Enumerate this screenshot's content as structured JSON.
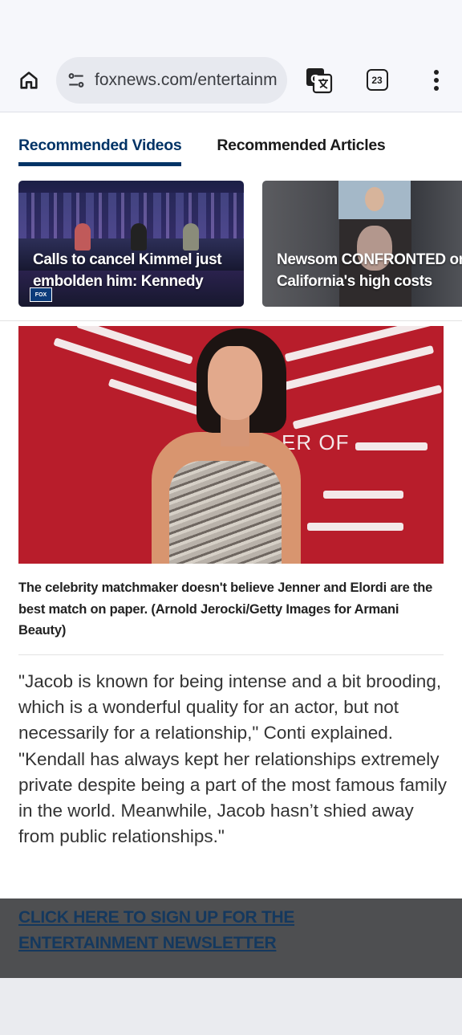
{
  "browser": {
    "url": "foxnews.com/entertainme",
    "tab_count": "23",
    "icons": {
      "home": "home-icon",
      "site_info": "tune-icon",
      "translate": "translate-icon",
      "tabs": "tabs-icon",
      "menu": "more-vert-icon"
    }
  },
  "recommended": {
    "tabs": [
      {
        "label": "Recommended Videos",
        "active": true
      },
      {
        "label": "Recommended Articles",
        "active": false
      }
    ],
    "videos": [
      {
        "title_line1": "Calls to cancel Kimmel just",
        "title_line2": "embolden him: Kennedy"
      },
      {
        "title_line1": "Newsom CONFRONTED on",
        "title_line2": "California's high costs"
      }
    ]
  },
  "article": {
    "hero_sign_text": "ER OF",
    "caption": "The celebrity matchmaker doesn't believe Jenner and Elordi are the best match on paper. (Arnold Jerocki/Getty Images for Armani Beauty)",
    "body": "\"Jacob is known for being intense and a bit brooding, which is a wonderful quality for an actor, but not necessarily for a relationship,\" Conti explained. \"Kendall has always kept her relationships extremely private despite being a part of the most famous family in the world. Meanwhile, Jacob hasn’t shied away from public relationships.\"",
    "newsletter_link": "CLICK HERE TO SIGN UP FOR THE ENTERTAINMENT NEWSLETTER"
  },
  "colors": {
    "accent_navy": "#003366",
    "hero_red": "#b81d2b",
    "overlay_gray": "#4e4f51"
  }
}
